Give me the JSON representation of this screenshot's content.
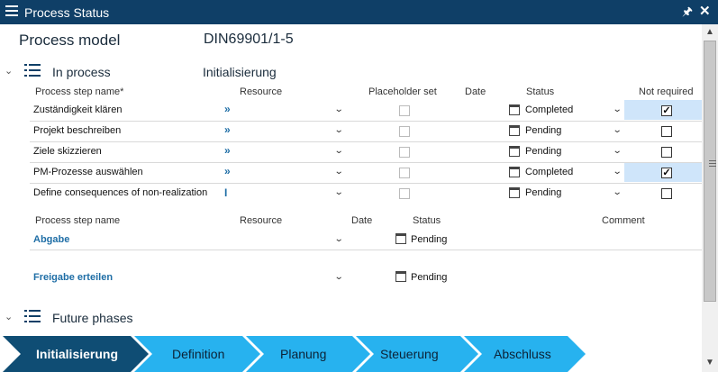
{
  "window": {
    "title": "Process Status"
  },
  "model": {
    "label": "Process model",
    "value": "DIN69901/1-5"
  },
  "in_process": {
    "label": "In process",
    "phase": "Initialisierung",
    "headers": {
      "name": "Process step name*",
      "resource": "Resource",
      "placeholder": "Placeholder set",
      "date": "Date",
      "status": "Status",
      "not_required": "Not required"
    },
    "rows": [
      {
        "name": "Zuständigkeit klären",
        "link": "»",
        "status": "Completed",
        "not_required": true
      },
      {
        "name": "Projekt beschreiben",
        "link": "»",
        "status": "Pending",
        "not_required": false
      },
      {
        "name": "Ziele skizzieren",
        "link": "»",
        "status": "Pending",
        "not_required": false
      },
      {
        "name": "PM-Prozesse auswählen",
        "link": "»",
        "status": "Completed",
        "not_required": true
      },
      {
        "name": "Define consequences of non-realization",
        "link": "I",
        "status": "Pending",
        "not_required": false
      }
    ]
  },
  "gates": {
    "headers": {
      "name": "Process step name",
      "resource": "Resource",
      "date": "Date",
      "status": "Status",
      "comment": "Comment"
    },
    "rows": [
      {
        "name": "Abgabe",
        "status": "Pending"
      },
      {
        "name": "Freigabe erteilen",
        "status": "Pending"
      }
    ]
  },
  "future": {
    "label": "Future phases"
  },
  "phases": [
    {
      "label": "Initialisierung",
      "active": true
    },
    {
      "label": "Definition",
      "active": false
    },
    {
      "label": "Planung",
      "active": false
    },
    {
      "label": "Steuerung",
      "active": false
    },
    {
      "label": "Abschluss",
      "active": false
    }
  ],
  "colors": {
    "titlebar": "#0f3f67",
    "phase_active": "#0f4d74",
    "phase_inactive": "#27b2ef",
    "link": "#1f6ea6",
    "checkbox_highlight": "#cfe5fa"
  },
  "icons": {
    "menu": "hamburger-icon",
    "pin": "pin-icon",
    "close": "close-icon",
    "list": "list-icon",
    "calendar": "calendar-icon",
    "dropdown": "chevron-down-icon"
  }
}
